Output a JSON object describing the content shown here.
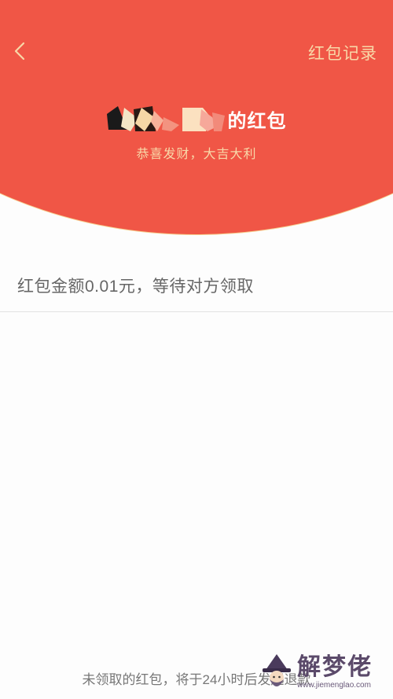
{
  "header": {
    "back_icon": "chevron-left-icon",
    "records_link": "红包记录",
    "sender_title_suffix": "的红包",
    "greeting": "恭喜发财，大吉大利"
  },
  "detail": {
    "amount_status": "红包金额0.01元，等待对方领取"
  },
  "footer": {
    "note": "未领取的红包，将于24小时后发起退款"
  },
  "watermark": {
    "title": "解梦佬",
    "url": "www.jiemenglao.com"
  },
  "colors": {
    "header_red": "#f05646",
    "status_bar": "#c7473a",
    "gold_text": "#f8d8a8",
    "body_bg": "#fdfdfd"
  }
}
